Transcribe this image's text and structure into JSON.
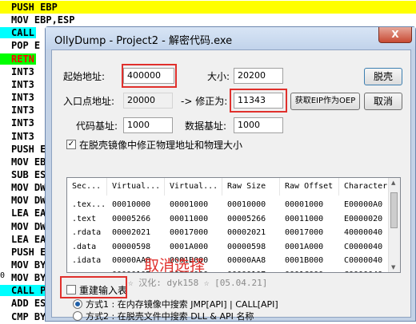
{
  "assembly": {
    "lines": [
      {
        "text": "PUSH EBP",
        "style": "yellow"
      },
      {
        "text": "MOV EBP,ESP",
        "style": ""
      },
      {
        "text": "CALL ",
        "style": "cyan"
      },
      {
        "text": "POP E",
        "style": ""
      },
      {
        "text": "RETN",
        "style": "green"
      },
      {
        "text": "INT3",
        "style": ""
      },
      {
        "text": "INT3",
        "style": ""
      },
      {
        "text": "INT3",
        "style": ""
      },
      {
        "text": "INT3",
        "style": ""
      },
      {
        "text": "INT3",
        "style": ""
      },
      {
        "text": "INT3",
        "style": ""
      },
      {
        "text": "PUSH E",
        "style": ""
      },
      {
        "text": "MOV EB",
        "style": ""
      },
      {
        "text": "SUB ES",
        "style": ""
      },
      {
        "text": "MOV DW",
        "style": ""
      },
      {
        "text": "MOV DW",
        "style": ""
      },
      {
        "text": "LEA EA",
        "style": ""
      },
      {
        "text": "MOV DW",
        "style": ""
      },
      {
        "text": "LEA EA",
        "style": ""
      },
      {
        "text": "PUSH E",
        "style": ""
      },
      {
        "text": "MOV BY",
        "style": ""
      },
      {
        "text": "MOV BY",
        "style": ""
      },
      {
        "text": "CALL P",
        "style": "cyan"
      },
      {
        "text": "ADD ES",
        "style": ""
      },
      {
        "text": "CMP BY",
        "style": ""
      }
    ],
    "left_marker": "0"
  },
  "dialog": {
    "title": "OllyDump - Project2 - 解密代码.exe",
    "close_label": "X",
    "start_addr_label": "起始地址:",
    "start_addr_value": "400000",
    "size_label": "大小:",
    "size_value": "20200",
    "dump_button": "脱壳",
    "entry_label": "入口点地址:",
    "entry_value": "20000",
    "modify_label": "-> 修正为:",
    "modify_value": "11343",
    "get_eip_button": "获取EIP作为OEP",
    "cancel_button": "取消",
    "code_base_label": "代码基址:",
    "code_base_value": "1000",
    "data_base_label": "数据基址:",
    "data_base_value": "1000",
    "fix_raw_label": "在脱壳镜像中修正物理地址和物理大小",
    "fix_raw_mark": "✓",
    "table": {
      "headers": [
        "Sec...",
        "Virtual...",
        "Virtual...",
        "Raw Size",
        "Raw Offset",
        "Characteris"
      ],
      "rows": [
        [
          ".tex...",
          "00010000",
          "00001000",
          "00010000",
          "00001000",
          "E00000A0"
        ],
        [
          ".text",
          "00005266",
          "00011000",
          "00005266",
          "00011000",
          "E0000020"
        ],
        [
          ".rdata",
          "00002021",
          "00017000",
          "00002021",
          "00017000",
          "40000040"
        ],
        [
          ".data",
          "00000598",
          "0001A000",
          "00000598",
          "0001A000",
          "C0000040"
        ],
        [
          ".idata",
          "00000AA8",
          "0001B000",
          "00000AA8",
          "0001B000",
          "C0000040"
        ],
        [
          "",
          "00000107",
          "0001C000",
          "00000107",
          "0001C000",
          "C0000040"
        ]
      ]
    },
    "rebuild_import_label": "重建输入表",
    "annotation": "取消选择",
    "method1_label": "方式1 : 在内存镜像中搜索 JMP[API] | CALL[API]",
    "method2_label": "方式2 : 在脱壳文件中搜索 DLL & API 名称",
    "credits": "☆ 汉化: dyk158 ☆ [05.04.21]"
  }
}
